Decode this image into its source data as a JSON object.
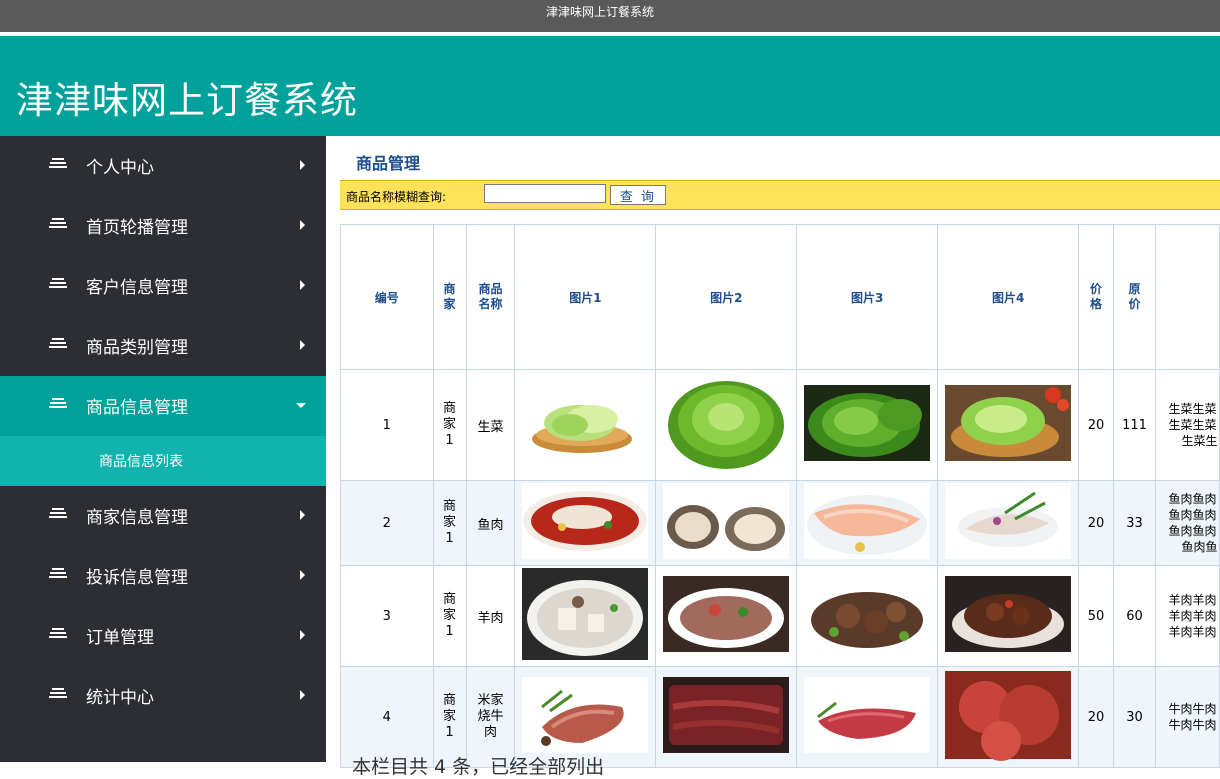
{
  "window": {
    "title": "津津味网上订餐系统"
  },
  "header": {
    "title": "津津味网上订餐系统"
  },
  "sidebar": {
    "items": [
      {
        "label": "个人中心"
      },
      {
        "label": "首页轮播管理"
      },
      {
        "label": "客户信息管理"
      },
      {
        "label": "商品类别管理"
      },
      {
        "label": "商品信息管理",
        "active": true
      },
      {
        "label": "商家信息管理"
      },
      {
        "label": "投诉信息管理"
      },
      {
        "label": "订单管理"
      },
      {
        "label": "统计中心"
      }
    ],
    "sub_item": {
      "label": "商品信息列表"
    }
  },
  "main": {
    "title": "商品管理",
    "search": {
      "label": "商品名称模糊查询:",
      "value": "",
      "button": "查 询"
    },
    "table": {
      "headers": [
        "编号",
        "商家",
        "商品名称",
        "图片1",
        "图片2",
        "图片3",
        "图片4",
        "价格",
        "原价"
      ],
      "rows": [
        {
          "id": "1",
          "merchant": "商家1",
          "name": "生菜",
          "price": "20",
          "orig_price": "111",
          "desc": [
            "生菜生菜",
            "生菜生菜",
            "生菜生"
          ]
        },
        {
          "id": "2",
          "merchant": "商家1",
          "name": "鱼肉",
          "price": "20",
          "orig_price": "33",
          "desc": [
            "鱼肉鱼肉",
            "鱼肉鱼肉",
            "鱼肉鱼肉",
            "鱼肉鱼"
          ]
        },
        {
          "id": "3",
          "merchant": "商家1",
          "name": "羊肉",
          "price": "50",
          "orig_price": "60",
          "desc": [
            "羊肉羊肉",
            "羊肉羊肉",
            "羊肉羊肉"
          ]
        },
        {
          "id": "4",
          "merchant": "商家1",
          "name": "米家烧牛肉",
          "price": "20",
          "orig_price": "30",
          "desc": [
            "牛肉牛肉",
            "牛肉牛肉"
          ]
        }
      ]
    },
    "footer": "本栏目共 4 条，已经全部列出"
  },
  "colors": {
    "teal": "#00a19b",
    "sidebar_bg": "#2c2e33",
    "topbar_bg": "#5a5a5a",
    "search_bar": "#fde25a",
    "title_blue": "#1f4e8c"
  }
}
